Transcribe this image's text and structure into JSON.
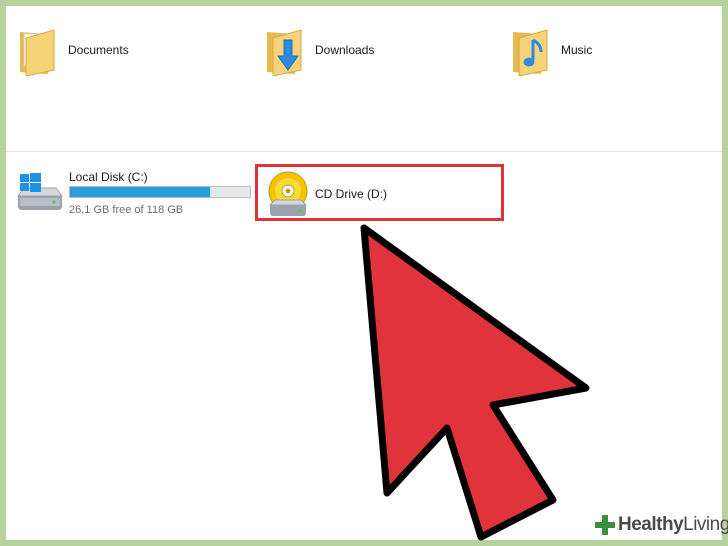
{
  "folders": [
    {
      "name": "Documents",
      "icon": "documents-folder-icon"
    },
    {
      "name": "Downloads",
      "icon": "downloads-folder-icon"
    },
    {
      "name": "Music",
      "icon": "music-folder-icon"
    }
  ],
  "drives": [
    {
      "name": "Local Disk (C:)",
      "free_text": "26,1 GB free of 118 GB",
      "used_fraction": 0.779,
      "icon": "local-disk-icon"
    },
    {
      "name": "CD Drive (D:)",
      "icon": "cd-drive-icon",
      "highlighted": true
    }
  ],
  "pointer": {
    "icon": "arrow-cursor-icon",
    "color": "#e0333c"
  },
  "watermark": {
    "brand": "Healthy",
    "suffix": "Living"
  },
  "colors": {
    "frame": "#b7d29b",
    "highlight": "#e0333c",
    "progress": "#26a0da",
    "folder": "#f6d37b"
  }
}
